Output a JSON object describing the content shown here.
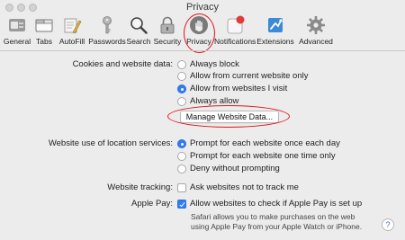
{
  "window": {
    "title": "Privacy"
  },
  "toolbar": {
    "items": [
      {
        "label": "General",
        "icon": "general-switch-icon"
      },
      {
        "label": "Tabs",
        "icon": "tabs-icon"
      },
      {
        "label": "AutoFill",
        "icon": "autofill-pencil-icon"
      },
      {
        "label": "Passwords",
        "icon": "key-icon"
      },
      {
        "label": "Search",
        "icon": "magnifier-icon"
      },
      {
        "label": "Security",
        "icon": "padlock-icon"
      },
      {
        "label": "Privacy",
        "icon": "hand-icon",
        "selected": true
      },
      {
        "label": "Notifications",
        "icon": "notifications-badge-icon"
      },
      {
        "label": "Extensions",
        "icon": "puzzle-icon"
      },
      {
        "label": "Advanced",
        "icon": "gear-icon"
      }
    ]
  },
  "cookies": {
    "label": "Cookies and website data:",
    "options": [
      {
        "label": "Always block",
        "selected": false
      },
      {
        "label": "Allow from current website only",
        "selected": false
      },
      {
        "label": "Allow from websites I visit",
        "selected": true
      },
      {
        "label": "Always allow",
        "selected": false
      }
    ],
    "manage_button": "Manage Website Data..."
  },
  "location": {
    "label": "Website use of location services:",
    "options": [
      {
        "label": "Prompt for each website once each day",
        "selected": true
      },
      {
        "label": "Prompt for each website one time only",
        "selected": false
      },
      {
        "label": "Deny without prompting",
        "selected": false
      }
    ]
  },
  "tracking": {
    "label": "Website tracking:",
    "checkbox": "Ask websites not to track me",
    "checked": false
  },
  "apple_pay": {
    "label": "Apple Pay:",
    "checkbox": "Allow websites to check if Apple Pay is set up",
    "checked": true,
    "note_line1": "Safari allows you to make purchases on the web",
    "note_line2": "using Apple Pay from your Apple Watch or iPhone."
  },
  "help": {
    "label": "?"
  },
  "colors": {
    "accent": "#2f7cf6",
    "annotation": "#e0141a"
  }
}
